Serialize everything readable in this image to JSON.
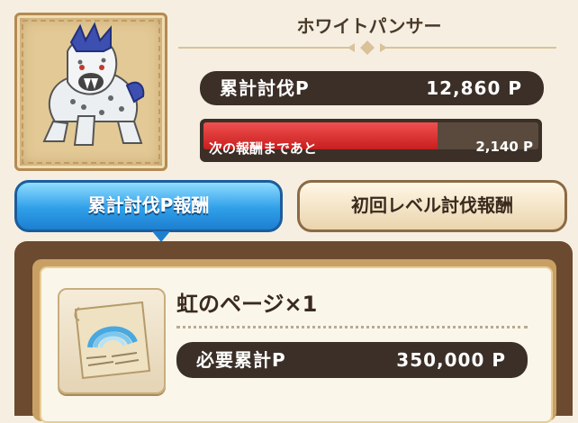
{
  "monster": {
    "name": "ホワイトパンサー",
    "kill_label": "累計討伐P",
    "kill_points": "12,860 P",
    "next_reward_label": "次の報酬まであと",
    "next_reward_remaining": "2,140 P",
    "progress_fraction": 0.7
  },
  "tabs": {
    "cumulative": "累計討伐P報酬",
    "first_level": "初回レベル討伐報酬"
  },
  "reward": {
    "item_name": "虹のページ×1",
    "required_label": "必要累計P",
    "required_points": "350,000 P"
  },
  "colors": {
    "tab_active": "#2f9fe8",
    "gauge_fill": "#e03232",
    "pill_bg": "#3b2f27"
  }
}
